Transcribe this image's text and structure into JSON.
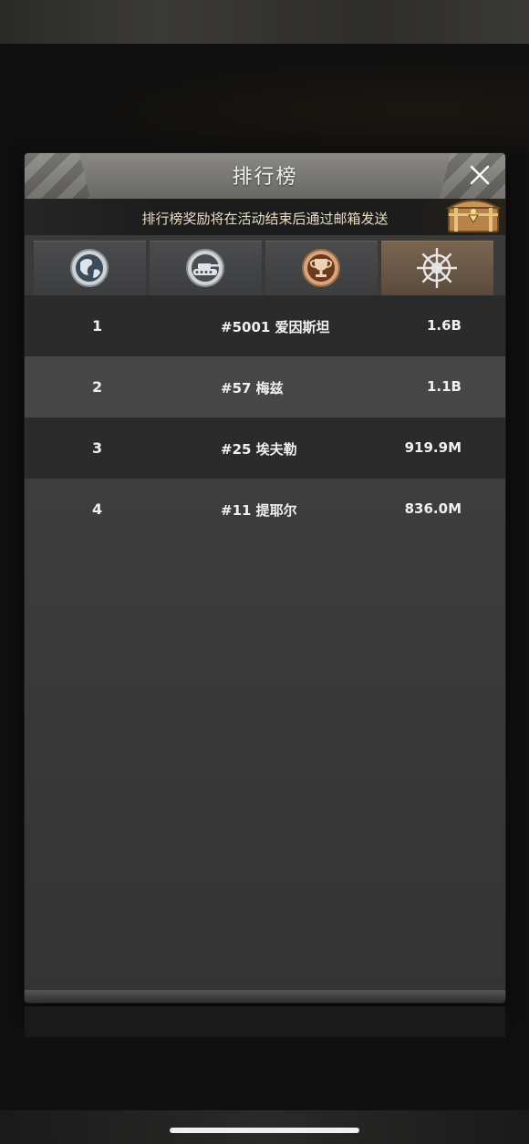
{
  "header": {
    "title": "排行榜",
    "close_icon": "close-icon"
  },
  "notice": {
    "text": "排行榜奖励将在活动结束后通过邮箱发送",
    "reward_icon": "treasure-chest-icon"
  },
  "tabs": [
    {
      "icon": "globe-icon",
      "active": false
    },
    {
      "icon": "tank-icon",
      "active": false
    },
    {
      "icon": "trophy-icon",
      "active": false
    },
    {
      "icon": "ship-wheel-icon",
      "active": true
    }
  ],
  "leaderboard": [
    {
      "rank": "1",
      "name": "#5001 爱因斯坦",
      "score": "1.6B"
    },
    {
      "rank": "2",
      "name": "#57 梅兹",
      "score": "1.1B"
    },
    {
      "rank": "3",
      "name": "#25 埃夫勒",
      "score": "919.9M"
    },
    {
      "rank": "4",
      "name": "#11 提耶尔",
      "score": "836.0M"
    }
  ],
  "colors": {
    "active_tab": "#6b5646",
    "notice_text": "#e9dcc3"
  }
}
